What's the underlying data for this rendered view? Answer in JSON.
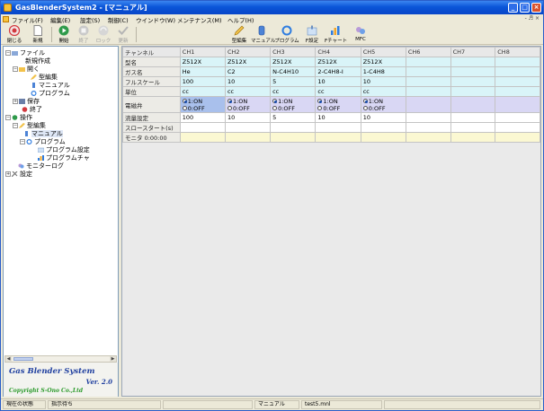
{
  "window": {
    "title": "GasBlenderSystem2 - [マニュアル]"
  },
  "menu": {
    "items": [
      "ファイル(F)",
      "編集(E)",
      "設定(S)",
      "制御(C)",
      "ウインドウ(W)",
      "メンテナンス(M)",
      "ヘルプ(H)"
    ],
    "doc_controls": "- ♬ ×"
  },
  "toolbar": {
    "close": "閉じる",
    "new": "新規",
    "start": "開始",
    "stop": "終了",
    "lock": "ロック",
    "update": "更新",
    "type_edit": "型編集",
    "manual": "マニュアル",
    "program": "プログラム",
    "f_set": "F設定",
    "f_chart": "Fチャート",
    "mfc": "MFC"
  },
  "tree": {
    "file": "ファイル",
    "new_create": "新規作成",
    "open": "開く",
    "type_edit": "型編集",
    "manual": "マニュアル",
    "program": "プログラム",
    "save": "保存",
    "end": "終了",
    "operation": "操作",
    "op_type_edit": "型編集",
    "op_manual": "マニュアル",
    "op_program": "プログラム",
    "prog_setting": "プログラム設定",
    "prog_chart": "プログラムチャ",
    "monitor_log": "モニターログ",
    "settings": "設定"
  },
  "brand": {
    "name": "Gas Blender System",
    "version": "Ver. 2.0",
    "copyright": "Copyright S-Ono Co.,Ltd"
  },
  "grid": {
    "headers": [
      "チャンネル",
      "CH1",
      "CH2",
      "CH3",
      "CH4",
      "CH5",
      "CH6",
      "CH7",
      "CH8"
    ],
    "rows": [
      {
        "label": "型名",
        "values": [
          "Z512X",
          "Z512X",
          "Z512X",
          "Z512X",
          "Z512X",
          "",
          "",
          ""
        ]
      },
      {
        "label": "ガス名",
        "values": [
          "He",
          "C2",
          "N-C4H10",
          "2-C4H8-I",
          "1-C4H8",
          "",
          "",
          ""
        ]
      },
      {
        "label": "フルスケール",
        "values": [
          "100",
          "10",
          "5",
          "10",
          "10",
          "",
          "",
          ""
        ]
      },
      {
        "label": "単位",
        "values": [
          "cc",
          "cc",
          "cc",
          "cc",
          "cc",
          "",
          "",
          ""
        ]
      }
    ],
    "valve_label": "電磁弁",
    "valve_on": "1:ON",
    "valve_off": "0:OFF",
    "flow_label": "流量設定",
    "flow_values": [
      "100",
      "10",
      "5",
      "10",
      "10",
      "",
      "",
      ""
    ],
    "slow_start_label": "スロースタート(s)",
    "monitor_label": "モニタ 0:00:00"
  },
  "status": {
    "s1": "現在の状態",
    "s2": "指示待ち",
    "s3": "マニュアル",
    "s4": "test5.mnl"
  }
}
